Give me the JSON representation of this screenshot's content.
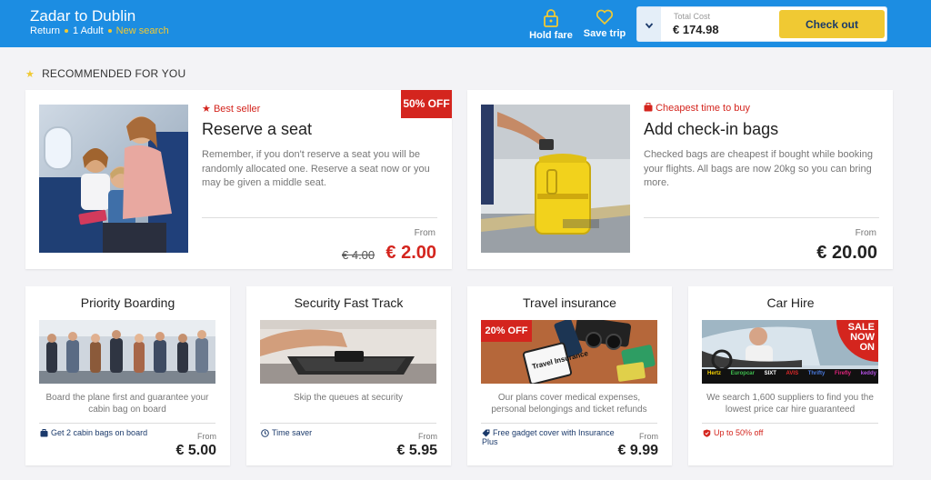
{
  "header": {
    "route": "Zadar to Dublin",
    "trip_type": "Return",
    "passengers": "1 Adult",
    "new_search": "New search",
    "hold_fare": "Hold fare",
    "save_trip": "Save trip",
    "total_cost_label": "Total Cost",
    "total_cost": "€ 174.98",
    "checkout": "Check out"
  },
  "section": {
    "title": "RECOMMENDED FOR YOU"
  },
  "featured": [
    {
      "tag": "Best seller",
      "title": "Reserve a seat",
      "description": "Remember, if you don't reserve a seat you will be randomly allocated one. Reserve a seat now or you may be given a middle seat.",
      "from": "From",
      "old_price": "€ 4.00",
      "price": "€ 2.00",
      "ribbon": "50% OFF"
    },
    {
      "tag": "Cheapest time to buy",
      "title": "Add check-in bags",
      "description": "Checked bags are cheapest if bought while booking your flights. All bags are now 20kg so you can bring more.",
      "from": "From",
      "price": "€ 20.00"
    }
  ],
  "products": [
    {
      "title": "Priority Boarding",
      "description": "Board the plane first and guarantee your cabin bag on board",
      "perk": "Get 2 cabin bags on board",
      "perk_icon": "bag-icon",
      "from": "From",
      "price": "€ 5.00"
    },
    {
      "title": "Security Fast Track",
      "description": "Skip the queues at security",
      "perk": "Time saver",
      "perk_icon": "clock-icon",
      "from": "From",
      "price": "€ 5.95"
    },
    {
      "title": "Travel insurance",
      "description": "Our plans cover medical expenses, personal belongings and ticket refunds",
      "perk": "Free gadget cover with Insurance Plus",
      "perk_icon": "tag-icon",
      "from": "From",
      "price": "€ 9.99",
      "ribbon": "20% OFF",
      "card_text": "Travel Insurance"
    },
    {
      "title": "Car Hire",
      "description": "We search 1,600 suppliers to find you the lowest price car hire guaranteed",
      "perk": "Up to 50% off",
      "perk_icon": "shield-icon",
      "sale_line1": "SALE",
      "sale_line2": "NOW",
      "sale_line3": "ON",
      "brands": [
        "Hertz",
        "Europcar",
        "SIXT",
        "AVIS",
        "Thrifty",
        "Firefly",
        "keddy"
      ]
    }
  ],
  "colors": {
    "header": "#1c8de2",
    "accent": "#f0c933",
    "sale_red": "#d4251e",
    "navy": "#1b3a6b"
  }
}
